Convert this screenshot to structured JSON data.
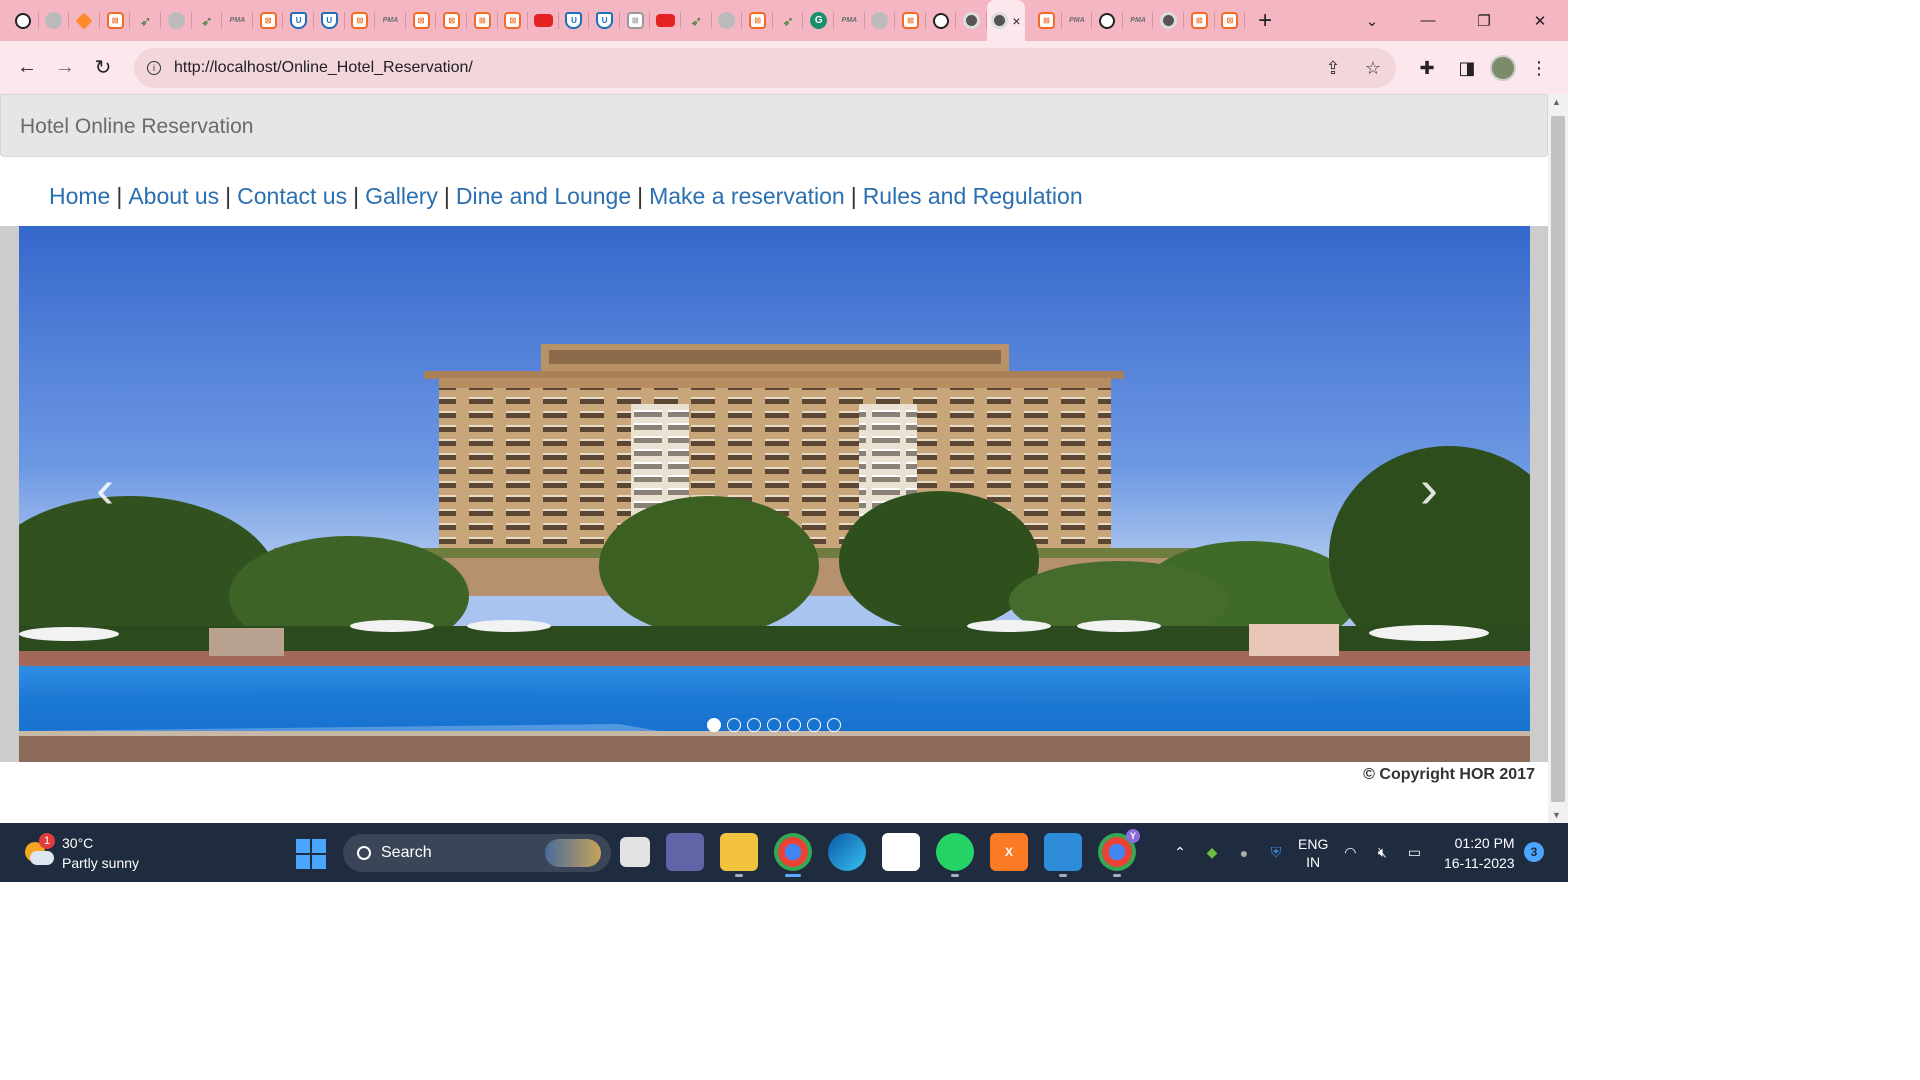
{
  "browser": {
    "url": "http://localhost/Online_Hotel_Reservation/",
    "active_tab_close": "×",
    "new_tab": "+",
    "tab_list_icon": "chevron-down-icon",
    "tabs": [
      {
        "icon": "github-icon"
      },
      {
        "icon": "globe-icon"
      },
      {
        "icon": "diamond-icon"
      },
      {
        "icon": "xampp-icon"
      },
      {
        "icon": "feather-icon"
      },
      {
        "icon": "globe-icon"
      },
      {
        "icon": "feather-icon"
      },
      {
        "icon": "phpmyadmin-icon"
      },
      {
        "icon": "xampp-icon"
      },
      {
        "icon": "shield-icon"
      },
      {
        "icon": "shield-icon"
      },
      {
        "icon": "xampp-icon"
      },
      {
        "icon": "phpmyadmin-icon"
      },
      {
        "icon": "xampp-icon"
      },
      {
        "icon": "xampp-icon"
      },
      {
        "icon": "xampp-icon"
      },
      {
        "icon": "xampp-icon"
      },
      {
        "icon": "youtube-icon"
      },
      {
        "icon": "shield-icon"
      },
      {
        "icon": "shield-icon"
      },
      {
        "icon": "xampp-gray-icon"
      },
      {
        "icon": "youtube-icon"
      },
      {
        "icon": "feather-icon"
      },
      {
        "icon": "globe-icon"
      },
      {
        "icon": "xampp-icon"
      },
      {
        "icon": "feather-icon"
      },
      {
        "icon": "grammarly-icon"
      },
      {
        "icon": "phpmyadmin-icon"
      },
      {
        "icon": "globe-icon"
      },
      {
        "icon": "xampp-icon"
      },
      {
        "icon": "github-icon"
      },
      {
        "icon": "chrome-icon"
      }
    ],
    "tabs_after": [
      {
        "icon": "xampp-icon"
      },
      {
        "icon": "phpmyadmin-icon"
      },
      {
        "icon": "github-icon"
      },
      {
        "icon": "phpmyadmin-icon"
      },
      {
        "icon": "chrome-icon"
      },
      {
        "icon": "xampp-icon"
      },
      {
        "icon": "xampp-icon"
      }
    ]
  },
  "site": {
    "title": "Hotel Online Reservation",
    "nav": [
      "Home",
      "About us",
      "Contact us",
      "Gallery",
      "Dine and Lounge",
      "Make a reservation",
      "Rules and Regulation"
    ],
    "nav_separator": "|",
    "carousel": {
      "prev": "‹",
      "next": "›",
      "slide_count": 7,
      "active_index": 0
    },
    "footer": "© Copyright HOR 2017"
  },
  "taskbar": {
    "weather_temp": "30°C",
    "weather_desc": "Partly sunny",
    "weather_badge": "1",
    "search_label": "Search",
    "lang_line1": "ENG",
    "lang_line2": "IN",
    "time": "01:20 PM",
    "date": "16-11-2023",
    "notification_count": "3",
    "chrome_badge": "Y"
  },
  "colors": {
    "tabstrip": "#f4b6c2",
    "toolbar": "#fce8ec",
    "link": "#2a6fb0",
    "taskbar": "#1f2b3e"
  }
}
